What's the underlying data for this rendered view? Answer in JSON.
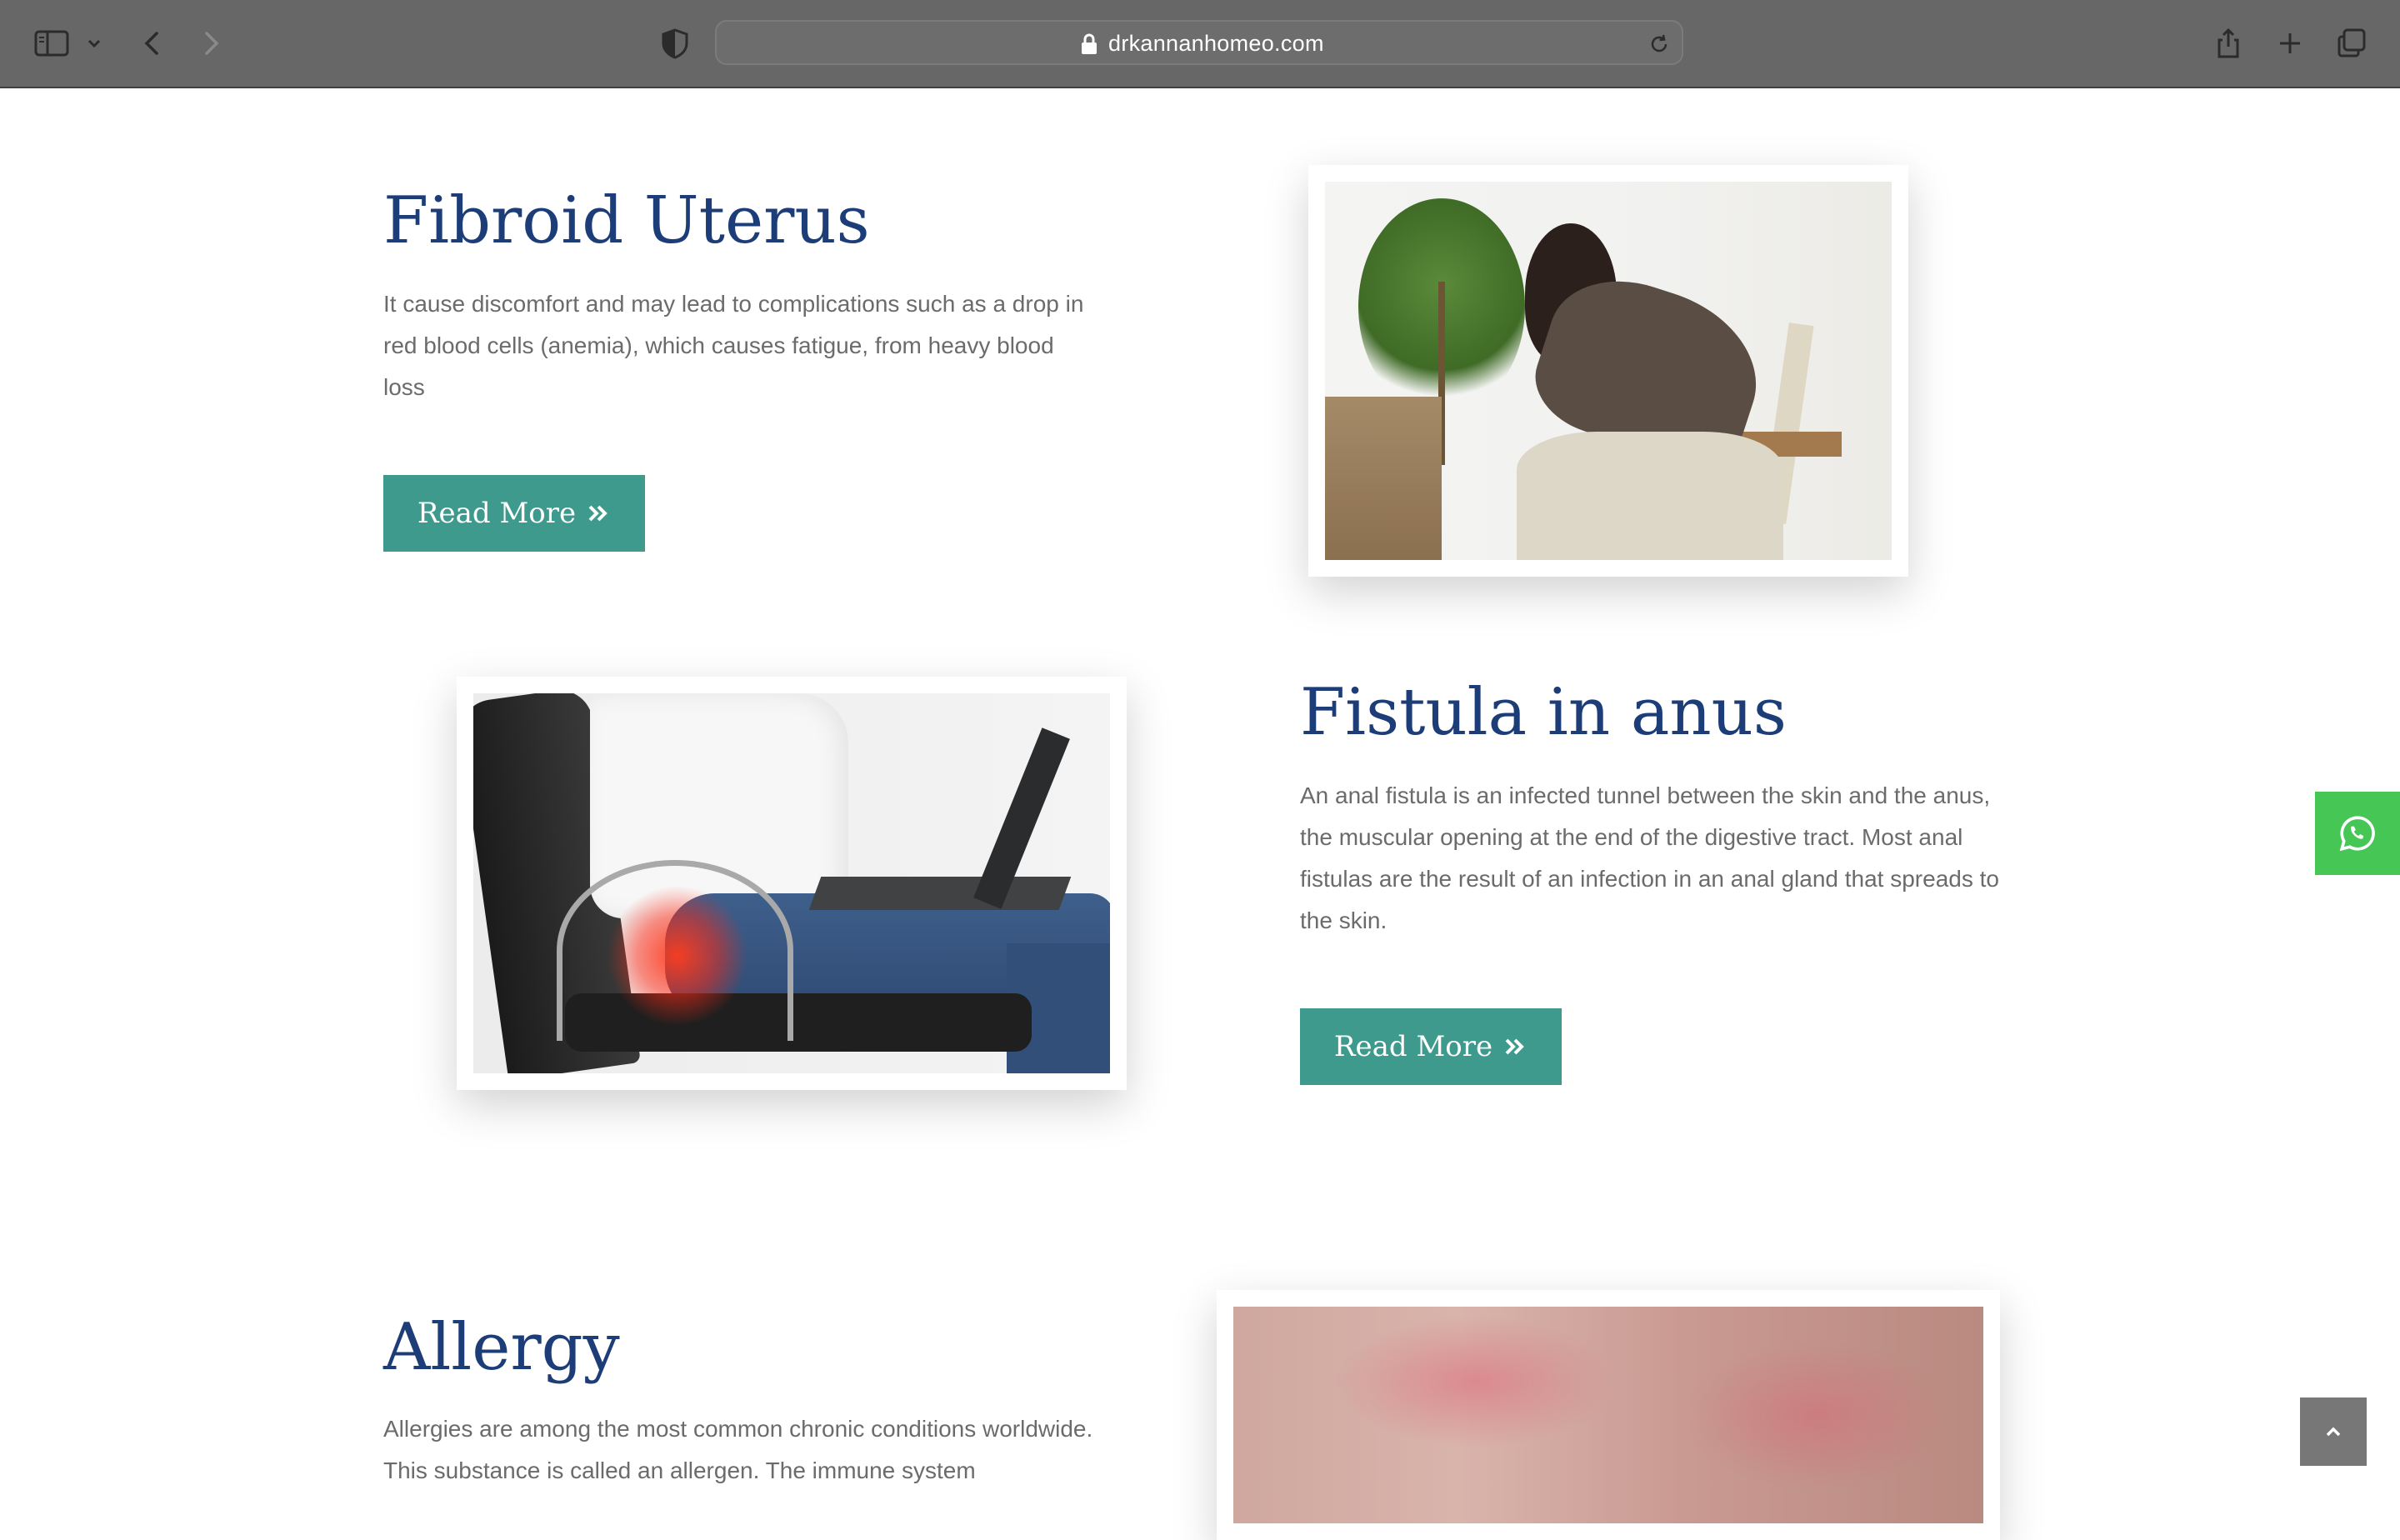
{
  "browser": {
    "url": "drkannanhomeo.com",
    "icons": [
      "sidebar-icon",
      "chevron-down-icon",
      "back-icon",
      "forward-icon",
      "shield-icon",
      "lock-icon",
      "reload-icon",
      "share-icon",
      "new-tab-icon",
      "tabs-overview-icon"
    ]
  },
  "sections": [
    {
      "title": "Fibroid Uterus",
      "description": "It cause discomfort and may lead to complications such as a drop in red blood cells (anemia), which causes fatigue, from heavy blood loss",
      "button_label": "Read More",
      "image": "woman-abdominal-pain-photo"
    },
    {
      "title": "Fistula in anus",
      "description": "An anal fistula is an infected tunnel between the skin and the anus, the muscular opening at the end of the digestive tract. Most anal fistulas are the result of an infection in an anal gland that spreads to the skin.",
      "button_label": "Read More",
      "image": "man-seated-pain-photo"
    },
    {
      "title": "Allergy",
      "description": "Allergies are among the most common chronic conditions worldwide. This substance is called an allergen. The immune system",
      "image": "skin-rash-photo"
    }
  ],
  "widgets": {
    "whatsapp_icon": "whatsapp-icon",
    "scroll_top_icon": "chevron-up-icon"
  },
  "colors": {
    "heading": "#1d3d78",
    "button": "#3e9a8c",
    "whatsapp": "#45c655",
    "toolbar": "#676767"
  }
}
